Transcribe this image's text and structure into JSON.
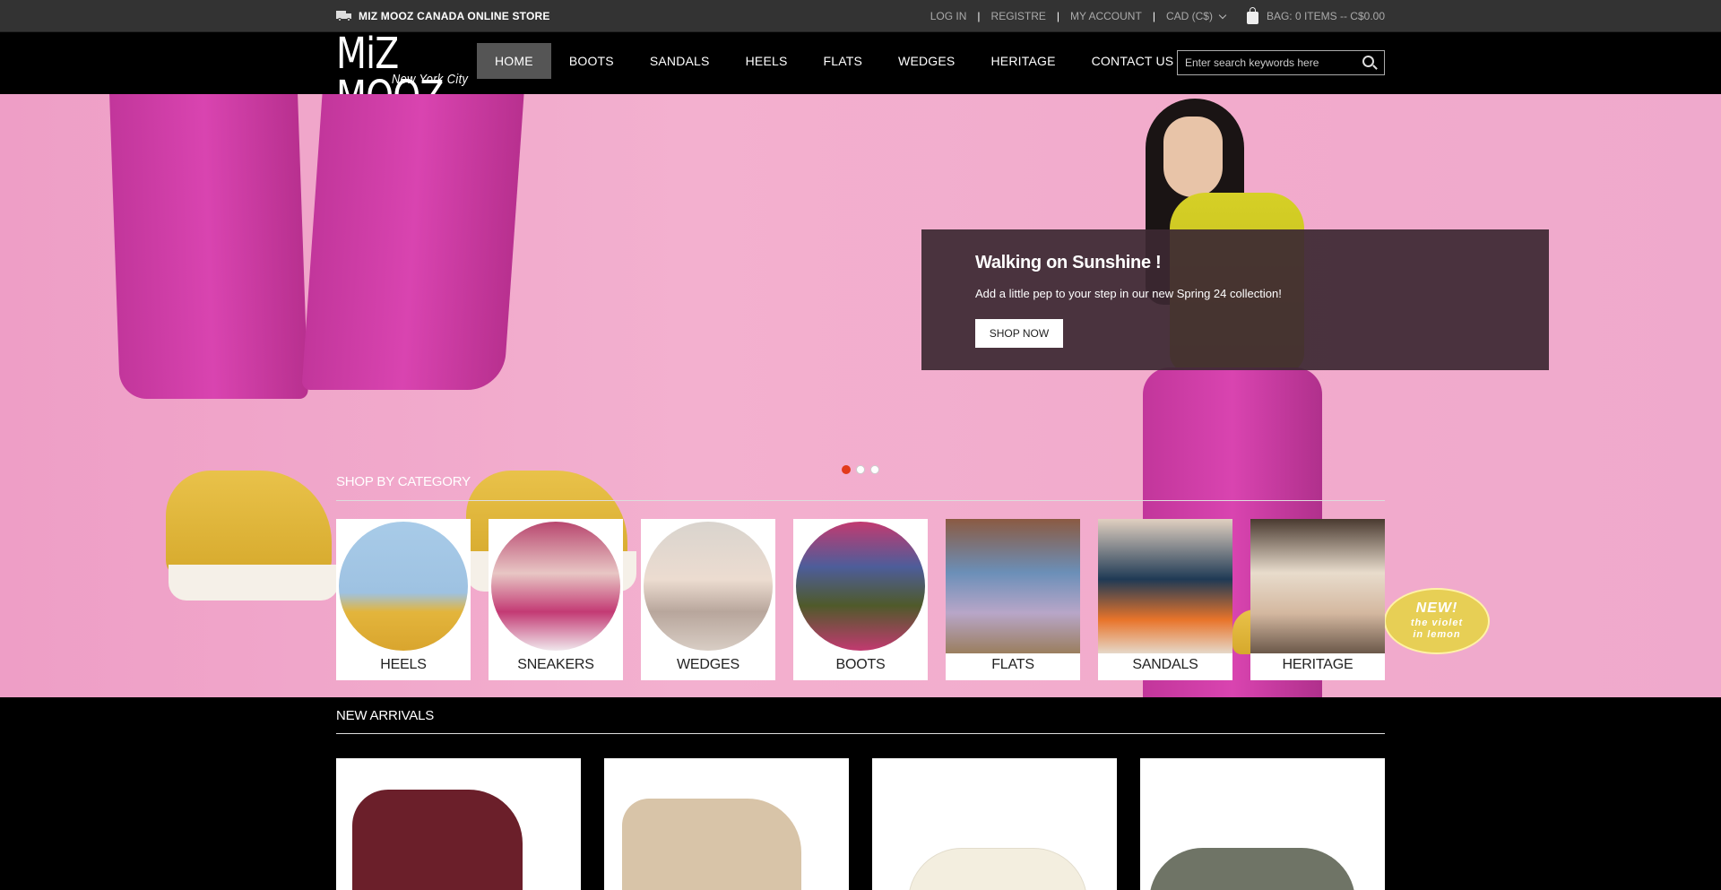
{
  "topbar": {
    "store_name": "MIZ MOOZ CANADA ONLINE STORE",
    "login": "LOG IN",
    "register": "REGISTRE",
    "account": "MY ACCOUNT",
    "currency": "CAD (C$)",
    "bag": "BAG: 0 Items -- C$0.00",
    "separator": "|"
  },
  "logo": {
    "line1": "MiZ MOOZ",
    "line2": "New York City"
  },
  "nav": {
    "items": [
      {
        "label": "HOME"
      },
      {
        "label": "BOOTS"
      },
      {
        "label": "SANDALS"
      },
      {
        "label": "HEELS"
      },
      {
        "label": "FLATS"
      },
      {
        "label": "WEDGES"
      },
      {
        "label": "HERITAGE"
      },
      {
        "label": "CONTACT US"
      }
    ]
  },
  "search": {
    "placeholder": "Enter search keywords here"
  },
  "hero": {
    "title": "Walking on Sunshine !",
    "text": "Add a little pep to your step in our new Spring 24 collection!",
    "button": "SHOP NOW",
    "active_slide": 1,
    "slides": 3
  },
  "categories": {
    "heading": "SHOP BY CATEGORY",
    "items": [
      {
        "label": "HEELS"
      },
      {
        "label": "SNEAKERS"
      },
      {
        "label": "WEDGES"
      },
      {
        "label": "BOOTS"
      },
      {
        "label": "FLATS"
      },
      {
        "label": "SANDALS"
      },
      {
        "label": "HERITAGE"
      }
    ]
  },
  "badge": {
    "line1": "NEW!",
    "line2": "the violet",
    "line3": "in lemon"
  },
  "new_arrivals": {
    "heading": "NEW ARRIVALS"
  },
  "colors": {
    "accent": "#e23b1b",
    "topbar": "#333333",
    "header": "#000000",
    "hero_bg": "#f2abcc",
    "slide_box": "#3c2832"
  }
}
